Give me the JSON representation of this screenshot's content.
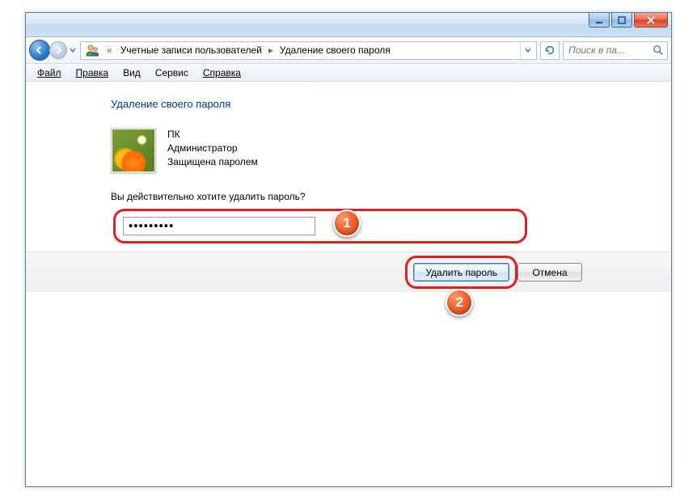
{
  "breadcrumb": {
    "seg1": "Учетные записи пользователей",
    "seg2": "Удаление своего пароля"
  },
  "search": {
    "placeholder": "Поиск в па..."
  },
  "menu": {
    "file": "Файл",
    "edit": "Правка",
    "view": "Вид",
    "tools": "Сервис",
    "help": "Справка"
  },
  "page": {
    "title": "Удаление своего пароля",
    "user_name": "ПК",
    "user_role": "Администратор",
    "user_protection": "Защищена паролем",
    "confirm_question": "Вы действительно хотите удалить пароль?",
    "password_value": "•••••••••"
  },
  "actions": {
    "delete": "Удалить пароль",
    "cancel": "Отмена"
  },
  "callouts": {
    "one": "1",
    "two": "2"
  }
}
